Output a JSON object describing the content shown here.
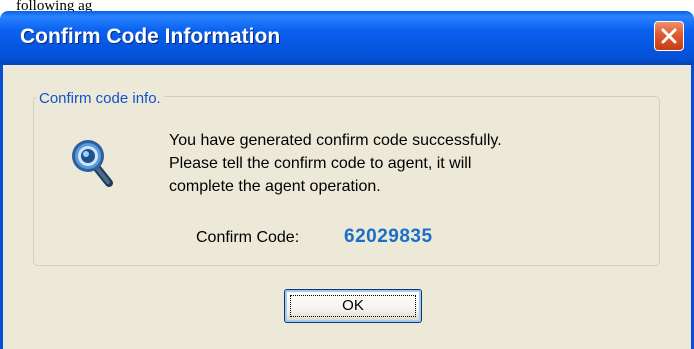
{
  "page_caption": "following ag",
  "dialog": {
    "title": "Confirm Code Information",
    "groupbox_label": "Confirm code info.",
    "message_lines": [
      "You have generated confirm code successfully.",
      "Please tell the confirm code to agent, it will",
      "complete the agent operation."
    ],
    "confirm_code_label": "Confirm Code:",
    "confirm_code_value": "62029835",
    "ok_button_label": "OK"
  },
  "icons": {
    "close": "close-icon",
    "info": "magnifier-icon"
  },
  "colors": {
    "titlebar": "#0650d4",
    "close_button": "#e05a30",
    "dialog_bg": "#ece9d8",
    "groupbox_label": "#1452c8",
    "code_value": "#1a6fc8"
  }
}
